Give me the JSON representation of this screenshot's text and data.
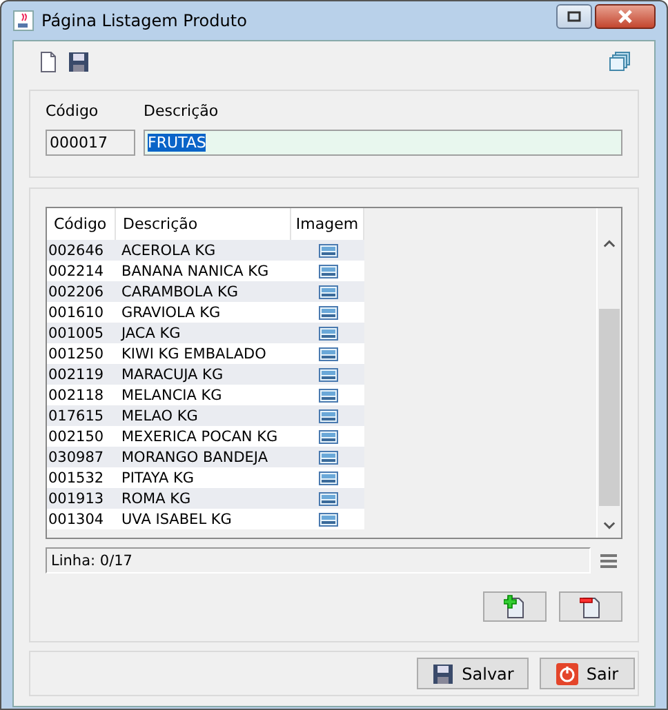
{
  "window": {
    "title": "Página Listagem Produto"
  },
  "form": {
    "code_label": "Código",
    "code_value": "000017",
    "description_label": "Descrição",
    "description_value": "FRUTAS"
  },
  "table": {
    "columns": [
      "Código",
      "Descrição",
      "Imagem"
    ],
    "rows": [
      {
        "code": "002646",
        "description": "ACEROLA KG"
      },
      {
        "code": "002214",
        "description": "BANANA NANICA KG"
      },
      {
        "code": "002206",
        "description": "CARAMBOLA KG"
      },
      {
        "code": "001610",
        "description": "GRAVIOLA KG"
      },
      {
        "code": "001005",
        "description": "JACA KG"
      },
      {
        "code": "001250",
        "description": "KIWI KG EMBALADO"
      },
      {
        "code": "002119",
        "description": "MARACUJA KG"
      },
      {
        "code": "002118",
        "description": "MELANCIA KG"
      },
      {
        "code": "017615",
        "description": "MELAO KG"
      },
      {
        "code": "002150",
        "description": "MEXERICA POCAN KG"
      },
      {
        "code": "030987",
        "description": "MORANGO BANDEJA"
      },
      {
        "code": "001532",
        "description": "PITAYA KG"
      },
      {
        "code": "001913",
        "description": "ROMA KG"
      },
      {
        "code": "001304",
        "description": "UVA ISABEL KG"
      }
    ]
  },
  "status": "Linha: 0/17",
  "buttons": [
    {
      "kind": "save",
      "label": "Salvar"
    },
    {
      "kind": "exit",
      "label": "Sair"
    }
  ]
}
